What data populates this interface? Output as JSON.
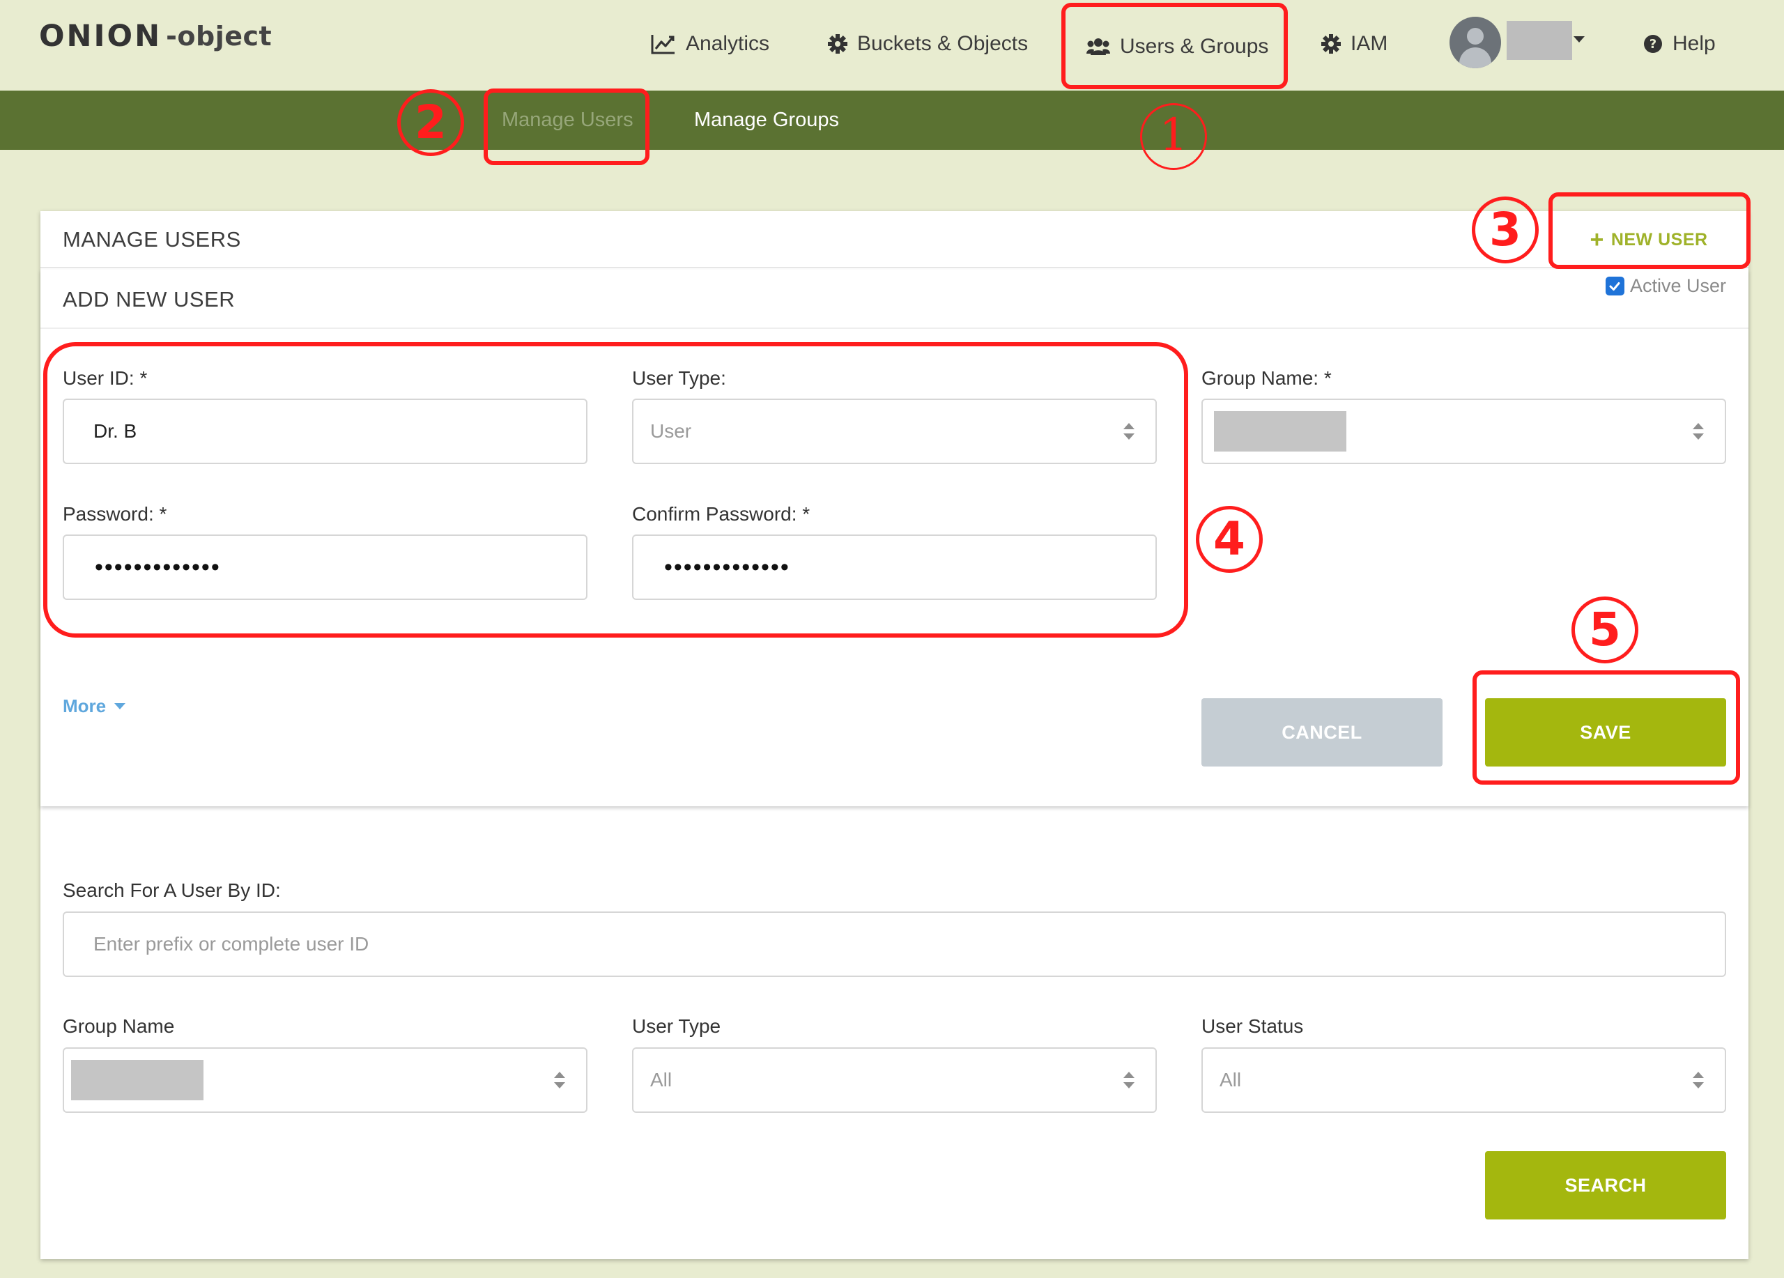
{
  "logo": {
    "part1": "ONIO",
    "part2": "N",
    "suffix": "-object"
  },
  "nav": {
    "analytics": "Analytics",
    "buckets": "Buckets & Objects",
    "users_groups": "Users & Groups",
    "iam": "IAM",
    "help": "Help"
  },
  "subnav": {
    "manage_users": "Manage Users",
    "manage_groups": "Manage Groups"
  },
  "manage_users": {
    "title": "MANAGE USERS",
    "new_user_button": "NEW USER"
  },
  "add_user": {
    "title": "ADD NEW USER",
    "active_user_label": "Active User",
    "active_user_checked": true,
    "user_id_label": "User ID: *",
    "user_id_value": "Dr. B",
    "user_type_label": "User Type:",
    "user_type_value": "User",
    "group_name_label": "Group Name: *",
    "password_label": "Password:  *",
    "password_value": "•••••••••••••",
    "confirm_password_label": "Confirm Password:  *",
    "confirm_password_value": "•••••••••••••",
    "more_label": "More",
    "cancel_button": "CANCEL",
    "save_button": "SAVE"
  },
  "search": {
    "search_label": "Search For A User By ID:",
    "search_placeholder": "Enter prefix or complete user ID",
    "group_name_label": "Group Name",
    "user_type_label": "User Type",
    "user_type_value": "All",
    "user_status_label": "User Status",
    "user_status_value": "All",
    "search_button": "SEARCH"
  },
  "annotations": {
    "step1": "1",
    "step2": "2",
    "step3": "3",
    "step4": "4",
    "step5": "5",
    "color": "#ff1d1d"
  },
  "colors": {
    "page_background": "#e8ecd0",
    "subnav_background": "#5b7232",
    "accent_green": "#a4b70e",
    "link_blue": "#5fa7dd"
  }
}
